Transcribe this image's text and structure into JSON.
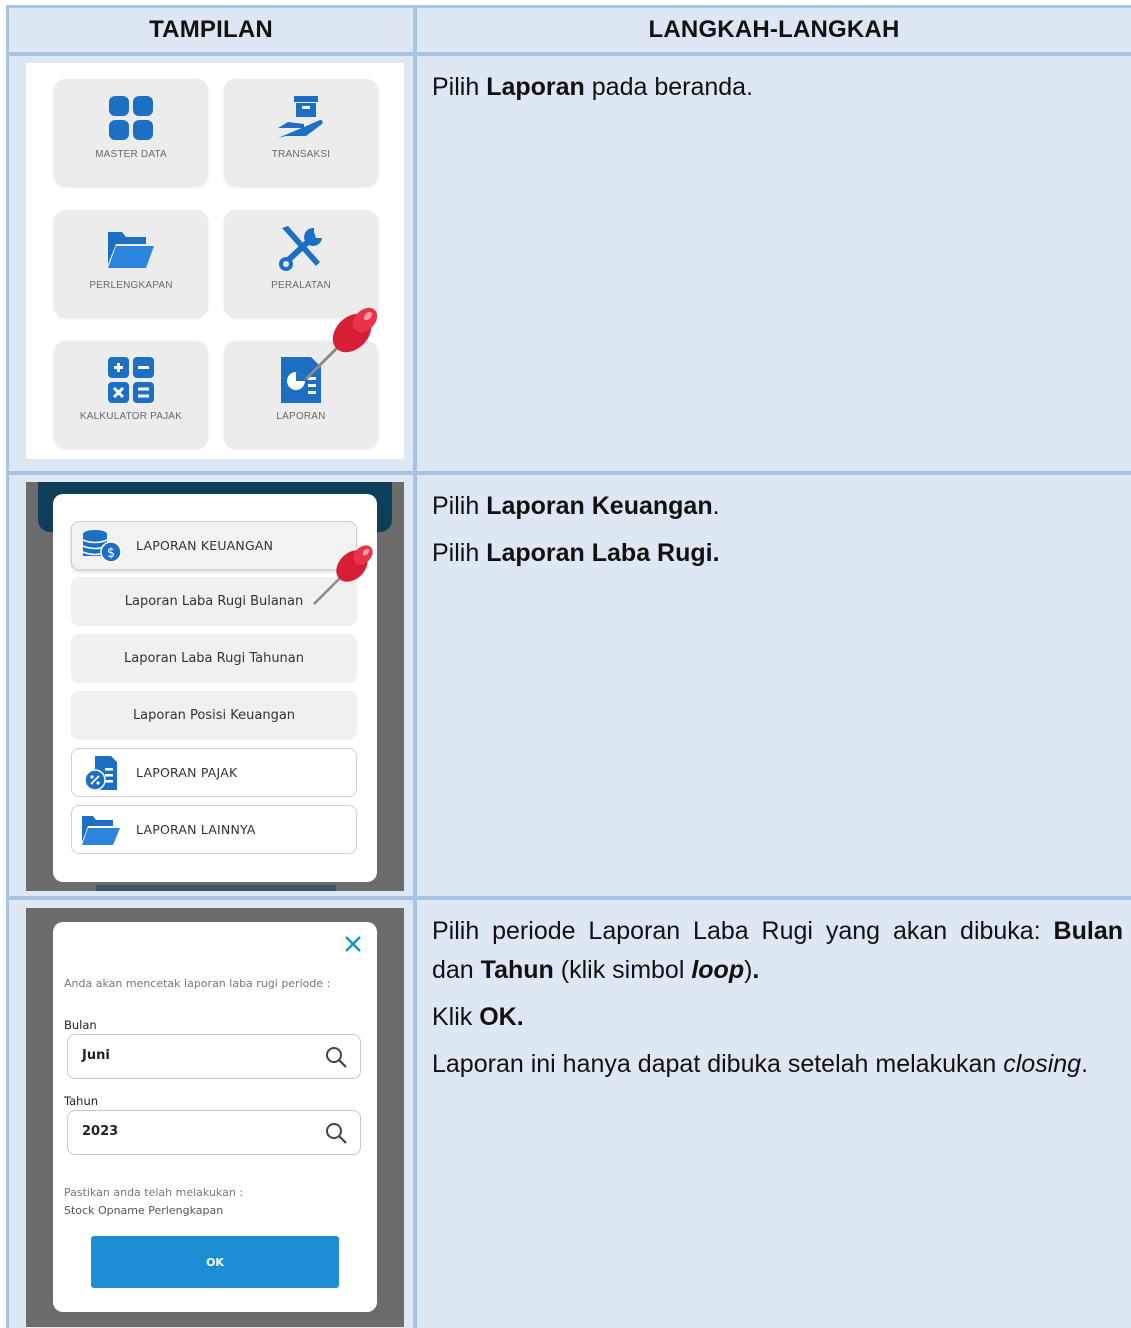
{
  "header": {
    "col1": "TAMPILAN",
    "col2": "LANGKAH-LANGKAH"
  },
  "row1": {
    "tiles": [
      {
        "label": "MASTER DATA",
        "icon": "grid-icon"
      },
      {
        "label": "TRANSAKSI",
        "icon": "hand-box-icon"
      },
      {
        "label": "PERLENGKAPAN",
        "icon": "folder-icon"
      },
      {
        "label": "PERALATAN",
        "icon": "tools-icon"
      },
      {
        "label": "KALKULATOR PAJAK",
        "icon": "calculator-icon"
      },
      {
        "label": "LAPORAN",
        "icon": "report-icon"
      }
    ],
    "step": {
      "pre": "Pilih ",
      "bold": "Laporan",
      "post": " pada beranda."
    }
  },
  "row2": {
    "options": {
      "keuangan": "LAPORAN KEUANGAN",
      "bulanan": "Laporan Laba Rugi Bulanan",
      "tahunan": "Laporan Laba Rugi Tahunan",
      "posisi": "Laporan Posisi Keuangan",
      "pajak": "LAPORAN PAJAK",
      "lainnya": "LAPORAN LAINNYA"
    },
    "step1": {
      "pre": "Pilih ",
      "bold": "Laporan Keuangan",
      "post": "."
    },
    "step2": {
      "pre": "Pilih ",
      "bold": "Laporan Laba Rugi."
    }
  },
  "row3": {
    "dialog": {
      "message": "Anda akan mencetak laporan laba rugi periode :",
      "bulan_label": "Bulan",
      "bulan_value": "Juni",
      "tahun_label": "Tahun",
      "tahun_value": "2023",
      "note_line1": "Pastikan anda telah melakukan :",
      "note_line2": "Stock Opname Perlengkapan",
      "ok_label": "OK"
    },
    "step1": {
      "pre": "Pilih periode Laporan Laba Rugi yang akan dibuka: ",
      "bold1": "Bulan",
      "mid": " dan ",
      "bold2": "Tahun",
      "paren_open": " (klik simbol ",
      "bolditalic": "loop",
      "paren_close": ")",
      "dot": "."
    },
    "step2": {
      "pre": "Klik ",
      "bold": "OK."
    },
    "step3": {
      "pre": "Laporan ini hanya dapat dibuka setelah melakukan ",
      "italic": "closing",
      "post": "."
    }
  }
}
